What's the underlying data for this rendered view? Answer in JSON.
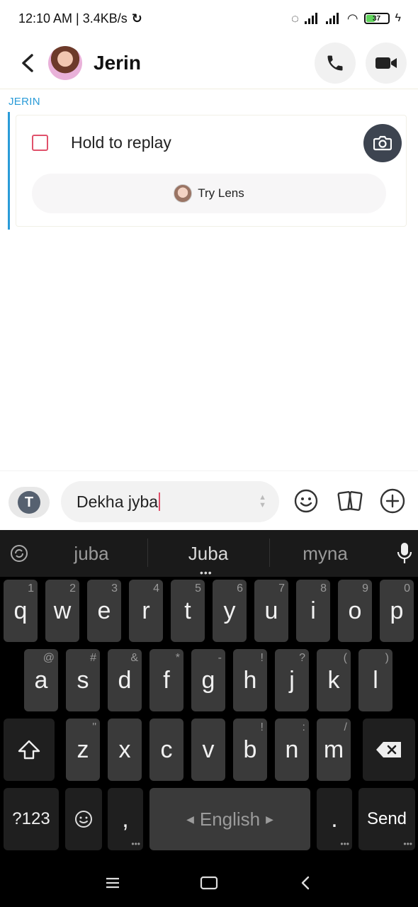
{
  "status_bar": {
    "time_speed": "12:10 AM | 3.4KB/s",
    "battery": "37"
  },
  "header": {
    "name": "Jerin"
  },
  "chat": {
    "sender": "JERIN",
    "snap_text": "Hold to replay",
    "lens_label": "Try Lens"
  },
  "composer": {
    "text": "Dekha jyba"
  },
  "keyboard": {
    "suggestions": [
      "juba",
      "Juba",
      "myna"
    ],
    "row1": [
      {
        "k": "q",
        "s": "1"
      },
      {
        "k": "w",
        "s": "2"
      },
      {
        "k": "e",
        "s": "3"
      },
      {
        "k": "r",
        "s": "4"
      },
      {
        "k": "t",
        "s": "5"
      },
      {
        "k": "y",
        "s": "6"
      },
      {
        "k": "u",
        "s": "7"
      },
      {
        "k": "i",
        "s": "8"
      },
      {
        "k": "o",
        "s": "9"
      },
      {
        "k": "p",
        "s": "0"
      }
    ],
    "row2": [
      {
        "k": "a",
        "s": "@"
      },
      {
        "k": "s",
        "s": "#"
      },
      {
        "k": "d",
        "s": "&"
      },
      {
        "k": "f",
        "s": "*"
      },
      {
        "k": "g",
        "s": "-"
      },
      {
        "k": "h",
        "s": "!"
      },
      {
        "k": "j",
        "s": "?"
      },
      {
        "k": "k",
        "s": "("
      },
      {
        "k": "l",
        "s": ")"
      }
    ],
    "row3": [
      {
        "k": "z",
        "s": "\""
      },
      {
        "k": "x",
        "s": ""
      },
      {
        "k": "c",
        "s": ""
      },
      {
        "k": "v",
        "s": ""
      },
      {
        "k": "b",
        "s": "!"
      },
      {
        "k": "n",
        "s": ":"
      },
      {
        "k": "m",
        "s": "/"
      }
    ],
    "symbols_key": "?123",
    "comma_key": ",",
    "space_label": "English",
    "period_key": ".",
    "send_key": "Send"
  }
}
